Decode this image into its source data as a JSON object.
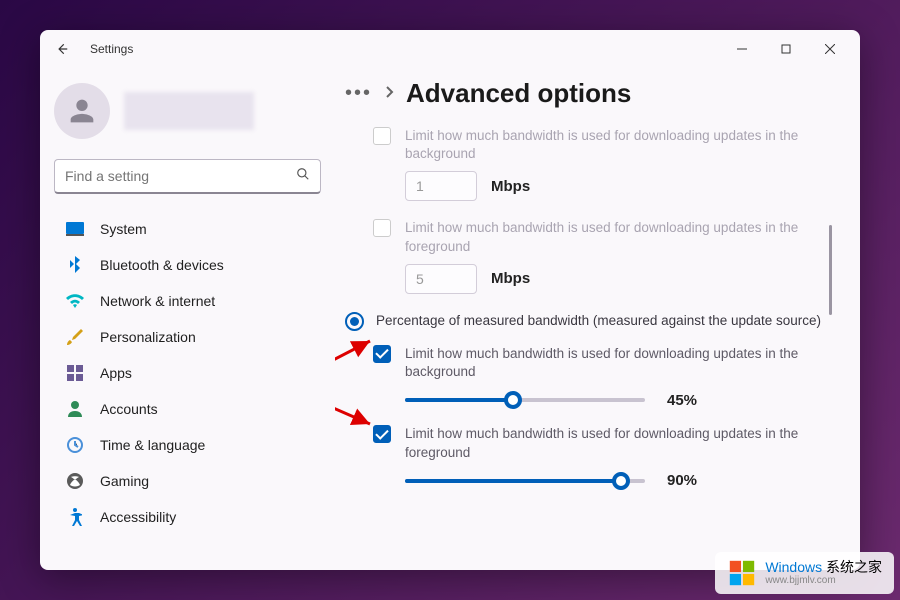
{
  "app_title": "Settings",
  "search": {
    "placeholder": "Find a setting"
  },
  "sidebar": {
    "items": [
      {
        "icon": "system",
        "label": "System"
      },
      {
        "icon": "bluetooth",
        "label": "Bluetooth & devices"
      },
      {
        "icon": "network",
        "label": "Network & internet"
      },
      {
        "icon": "personalization",
        "label": "Personalization"
      },
      {
        "icon": "apps",
        "label": "Apps"
      },
      {
        "icon": "accounts",
        "label": "Accounts"
      },
      {
        "icon": "time",
        "label": "Time & language"
      },
      {
        "icon": "gaming",
        "label": "Gaming"
      },
      {
        "icon": "accessibility",
        "label": "Accessibility"
      }
    ]
  },
  "breadcrumb": {
    "title": "Advanced options"
  },
  "options": {
    "abs_bg": {
      "checked": false,
      "enabled": false,
      "label": "Limit how much bandwidth is used for downloading updates in the background",
      "value": "1",
      "unit": "Mbps"
    },
    "abs_fg": {
      "checked": false,
      "enabled": false,
      "label": "Limit how much bandwidth is used for downloading updates in the foreground",
      "value": "5",
      "unit": "Mbps"
    },
    "percentage_radio": {
      "selected": true,
      "label": "Percentage of measured bandwidth (measured against the update source)"
    },
    "pct_bg": {
      "checked": true,
      "label": "Limit how much bandwidth is used for downloading updates in the background",
      "value": 45,
      "value_display": "45%"
    },
    "pct_fg": {
      "checked": true,
      "label": "Limit how much bandwidth is used for downloading updates in the foreground",
      "value": 90,
      "value_display": "90%"
    }
  },
  "watermark": {
    "brand_1": "Windows",
    "brand_2": " 系统之家",
    "url": "www.bjjmlv.com"
  }
}
